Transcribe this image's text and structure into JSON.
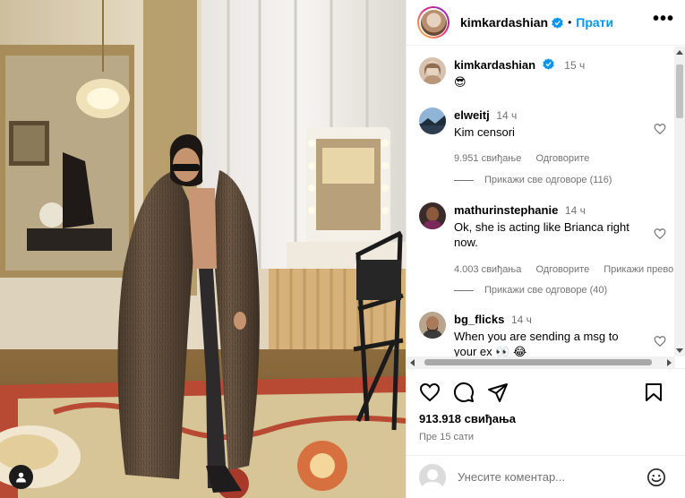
{
  "post": {
    "username": "kimkardashian",
    "follow_label": "Прати",
    "separator": "•",
    "caption": {
      "username": "kimkardashian",
      "time": "15 ч",
      "text": "😎"
    }
  },
  "comments": [
    {
      "username": "elweitj",
      "time": "14 ч",
      "text": "Kim censori",
      "likes": "9.951 свиђање",
      "reply_label": "Одговорите",
      "translate_label": "",
      "view_replies": "Прикажи све одговоре (116)"
    },
    {
      "username": "mathurinstephanie",
      "time": "14 ч",
      "text": "Ok, she is acting like Brianca right now.",
      "likes": "4.003 свиђања",
      "reply_label": "Одговорите",
      "translate_label": "Прикажи прево",
      "view_replies": "Прикажи све одговоре (40)"
    },
    {
      "username": "bg_flicks",
      "time": "14 ч",
      "text": "When you are sending a msg to your ex 👀 😂"
    }
  ],
  "actions": {
    "likes": "913.918 свиђања",
    "posted_ago": "Пре 15 сати"
  },
  "composer": {
    "placeholder": "Унесите коментар..."
  },
  "colors": {
    "accent": "#0095f6",
    "secondary_text": "#737373",
    "border": "#efefef"
  },
  "icons": {
    "verified": "verified-badge-icon",
    "like": "heart-icon",
    "comment": "comment-icon",
    "share": "send-icon",
    "save": "bookmark-icon",
    "more": "more-options-icon",
    "emoji": "emoji-icon",
    "user_tag": "user-tag-icon"
  }
}
